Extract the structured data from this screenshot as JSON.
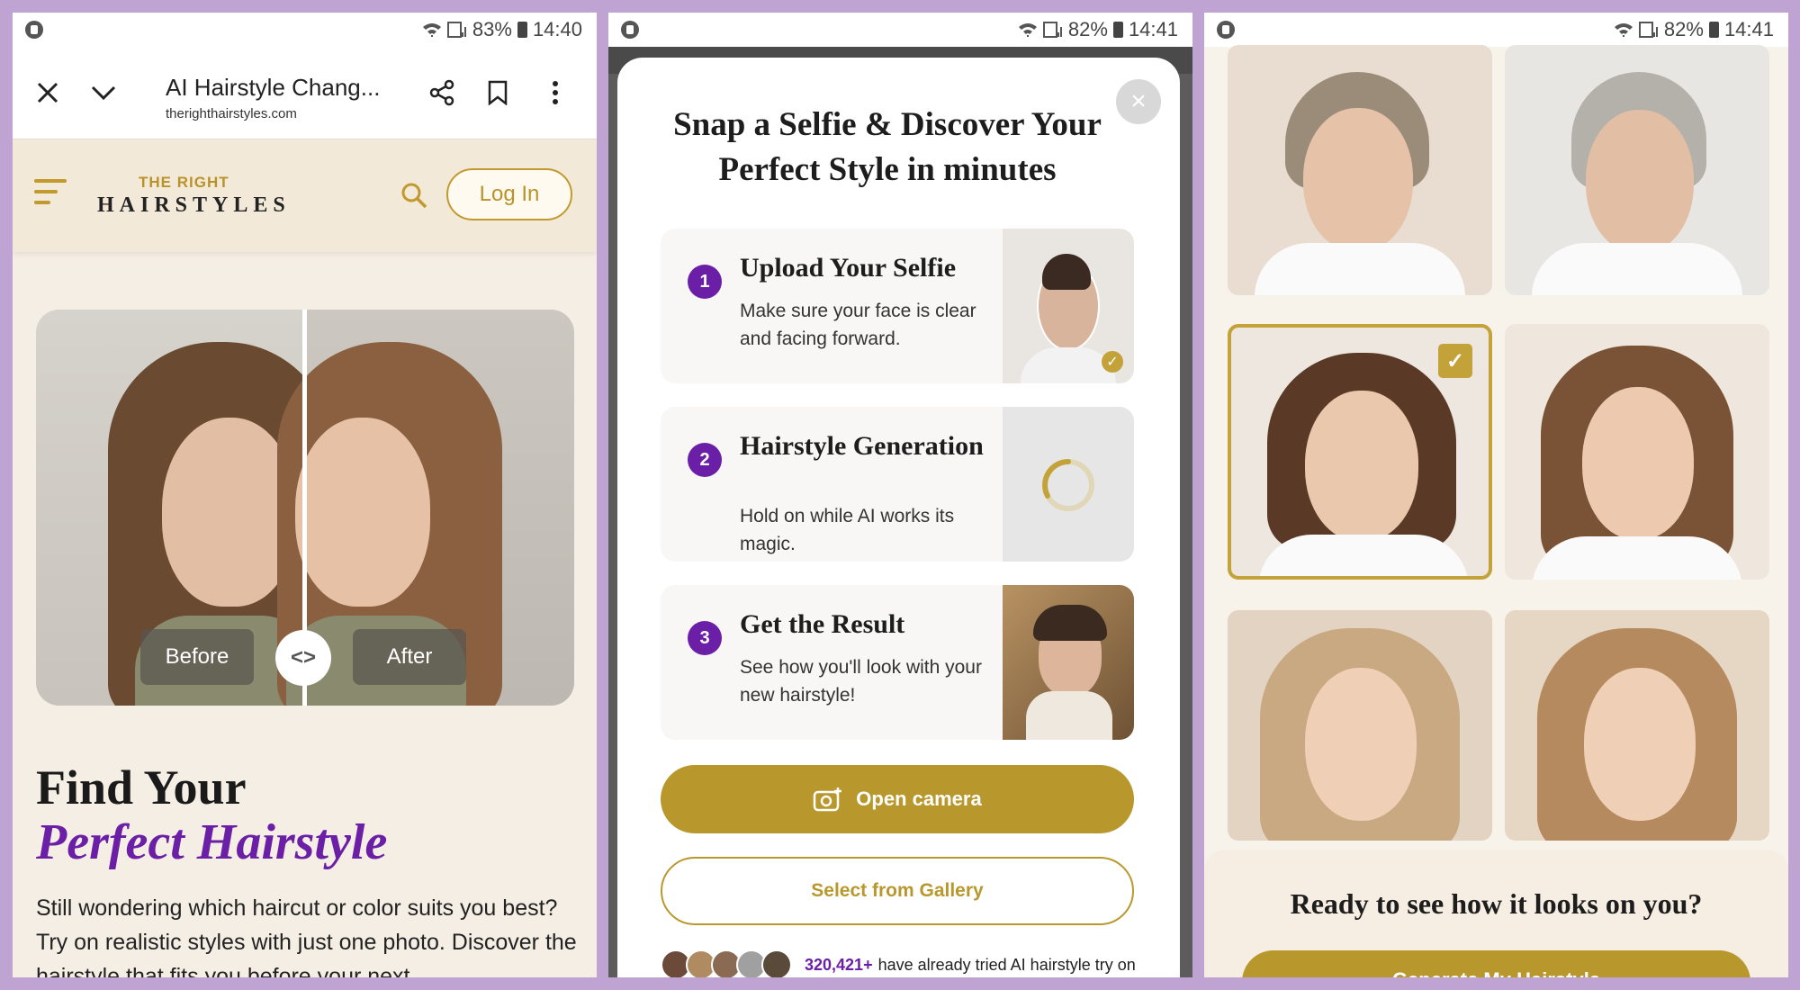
{
  "phone1": {
    "status": {
      "battery": "83%",
      "time": "14:40"
    },
    "browser": {
      "title": "AI Hairstyle Chang...",
      "url": "therighthairstyles.com"
    },
    "site": {
      "logo_top": "THE RIGHT",
      "logo_main": "HAIRSTYLES",
      "login_label": "Log In"
    },
    "hero": {
      "before_label": "Before",
      "after_label": "After",
      "slider_glyph": "<>"
    },
    "heading_line1": "Find Your",
    "heading_line2": "Perfect Hairstyle",
    "body": "Still wondering which haircut or color suits you best? Try on realistic styles with just one photo. Discover the hairstyle that fits you before your next"
  },
  "phone2": {
    "status": {
      "battery": "82%",
      "time": "14:41"
    },
    "close_glyph": "×",
    "title": "Snap a Selfie & Discover Your Perfect Style in minutes",
    "steps": [
      {
        "num": "1",
        "title": "Upload Your Selfie",
        "desc": "Make sure your face is clear and facing forward."
      },
      {
        "num": "2",
        "title": "Hairstyle Generation",
        "desc": "Hold on while AI works its magic."
      },
      {
        "num": "3",
        "title": "Get the Result",
        "desc": "See how you'll look with your new hairstyle!"
      }
    ],
    "open_camera_label": "Open camera",
    "gallery_label": "Select from Gallery",
    "social_count": "320,421+",
    "social_text": "have already tried AI hairstyle try on"
  },
  "phone3": {
    "status": {
      "battery": "82%",
      "time": "14:41"
    },
    "cta": "Ready to see how it looks on you?",
    "generate_label": "Generate My Hairstyle",
    "selected_tile": 2,
    "check_glyph": "✓"
  },
  "icons": {
    "close": "close-icon",
    "chevron": "chevron-down-icon",
    "share": "share-icon",
    "bookmark": "bookmark-icon",
    "more": "more-vertical-icon",
    "menu": "menu-icon",
    "search": "search-icon",
    "camera": "camera-plus-icon"
  },
  "colors": {
    "accent_gold": "#b8982c",
    "accent_purple": "#6a1fa6",
    "cream": "#f3e9d9"
  }
}
